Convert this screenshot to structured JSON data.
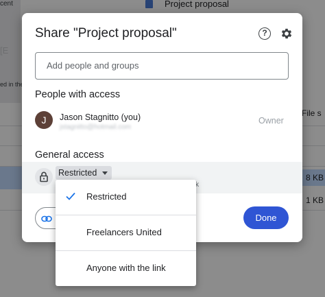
{
  "background": {
    "thumb_top_text": "cent",
    "thumb_mid_text": "[E",
    "thumb_caption": "ed in the",
    "doc_title": "Project proposal",
    "file_size_header": "File s",
    "sizes": [
      "8 KB",
      "1 KB"
    ]
  },
  "dialog": {
    "title": "Share \"Project proposal\"",
    "help_icon": "help-icon",
    "settings_icon": "gear-icon",
    "add_placeholder": "Add people and groups",
    "people_header": "People with access",
    "user": {
      "initial": "J",
      "name": "Jason Stagnitto (you)",
      "email": "jstagnitto@hotmail.com",
      "role": "Owner"
    },
    "general_header": "General access",
    "access_value": "Restricted",
    "access_sub": "k",
    "copy_link_icon": "link-icon",
    "done_label": "Done"
  },
  "menu": {
    "options": [
      "Restricted",
      "Freelancers United",
      "Anyone with the link"
    ],
    "selected": "Restricted",
    "accent": "#1a73e8"
  },
  "colors": {
    "primary": "#2f55d4",
    "avatar": "#5d4037",
    "selected_row": "#c2dbff"
  }
}
